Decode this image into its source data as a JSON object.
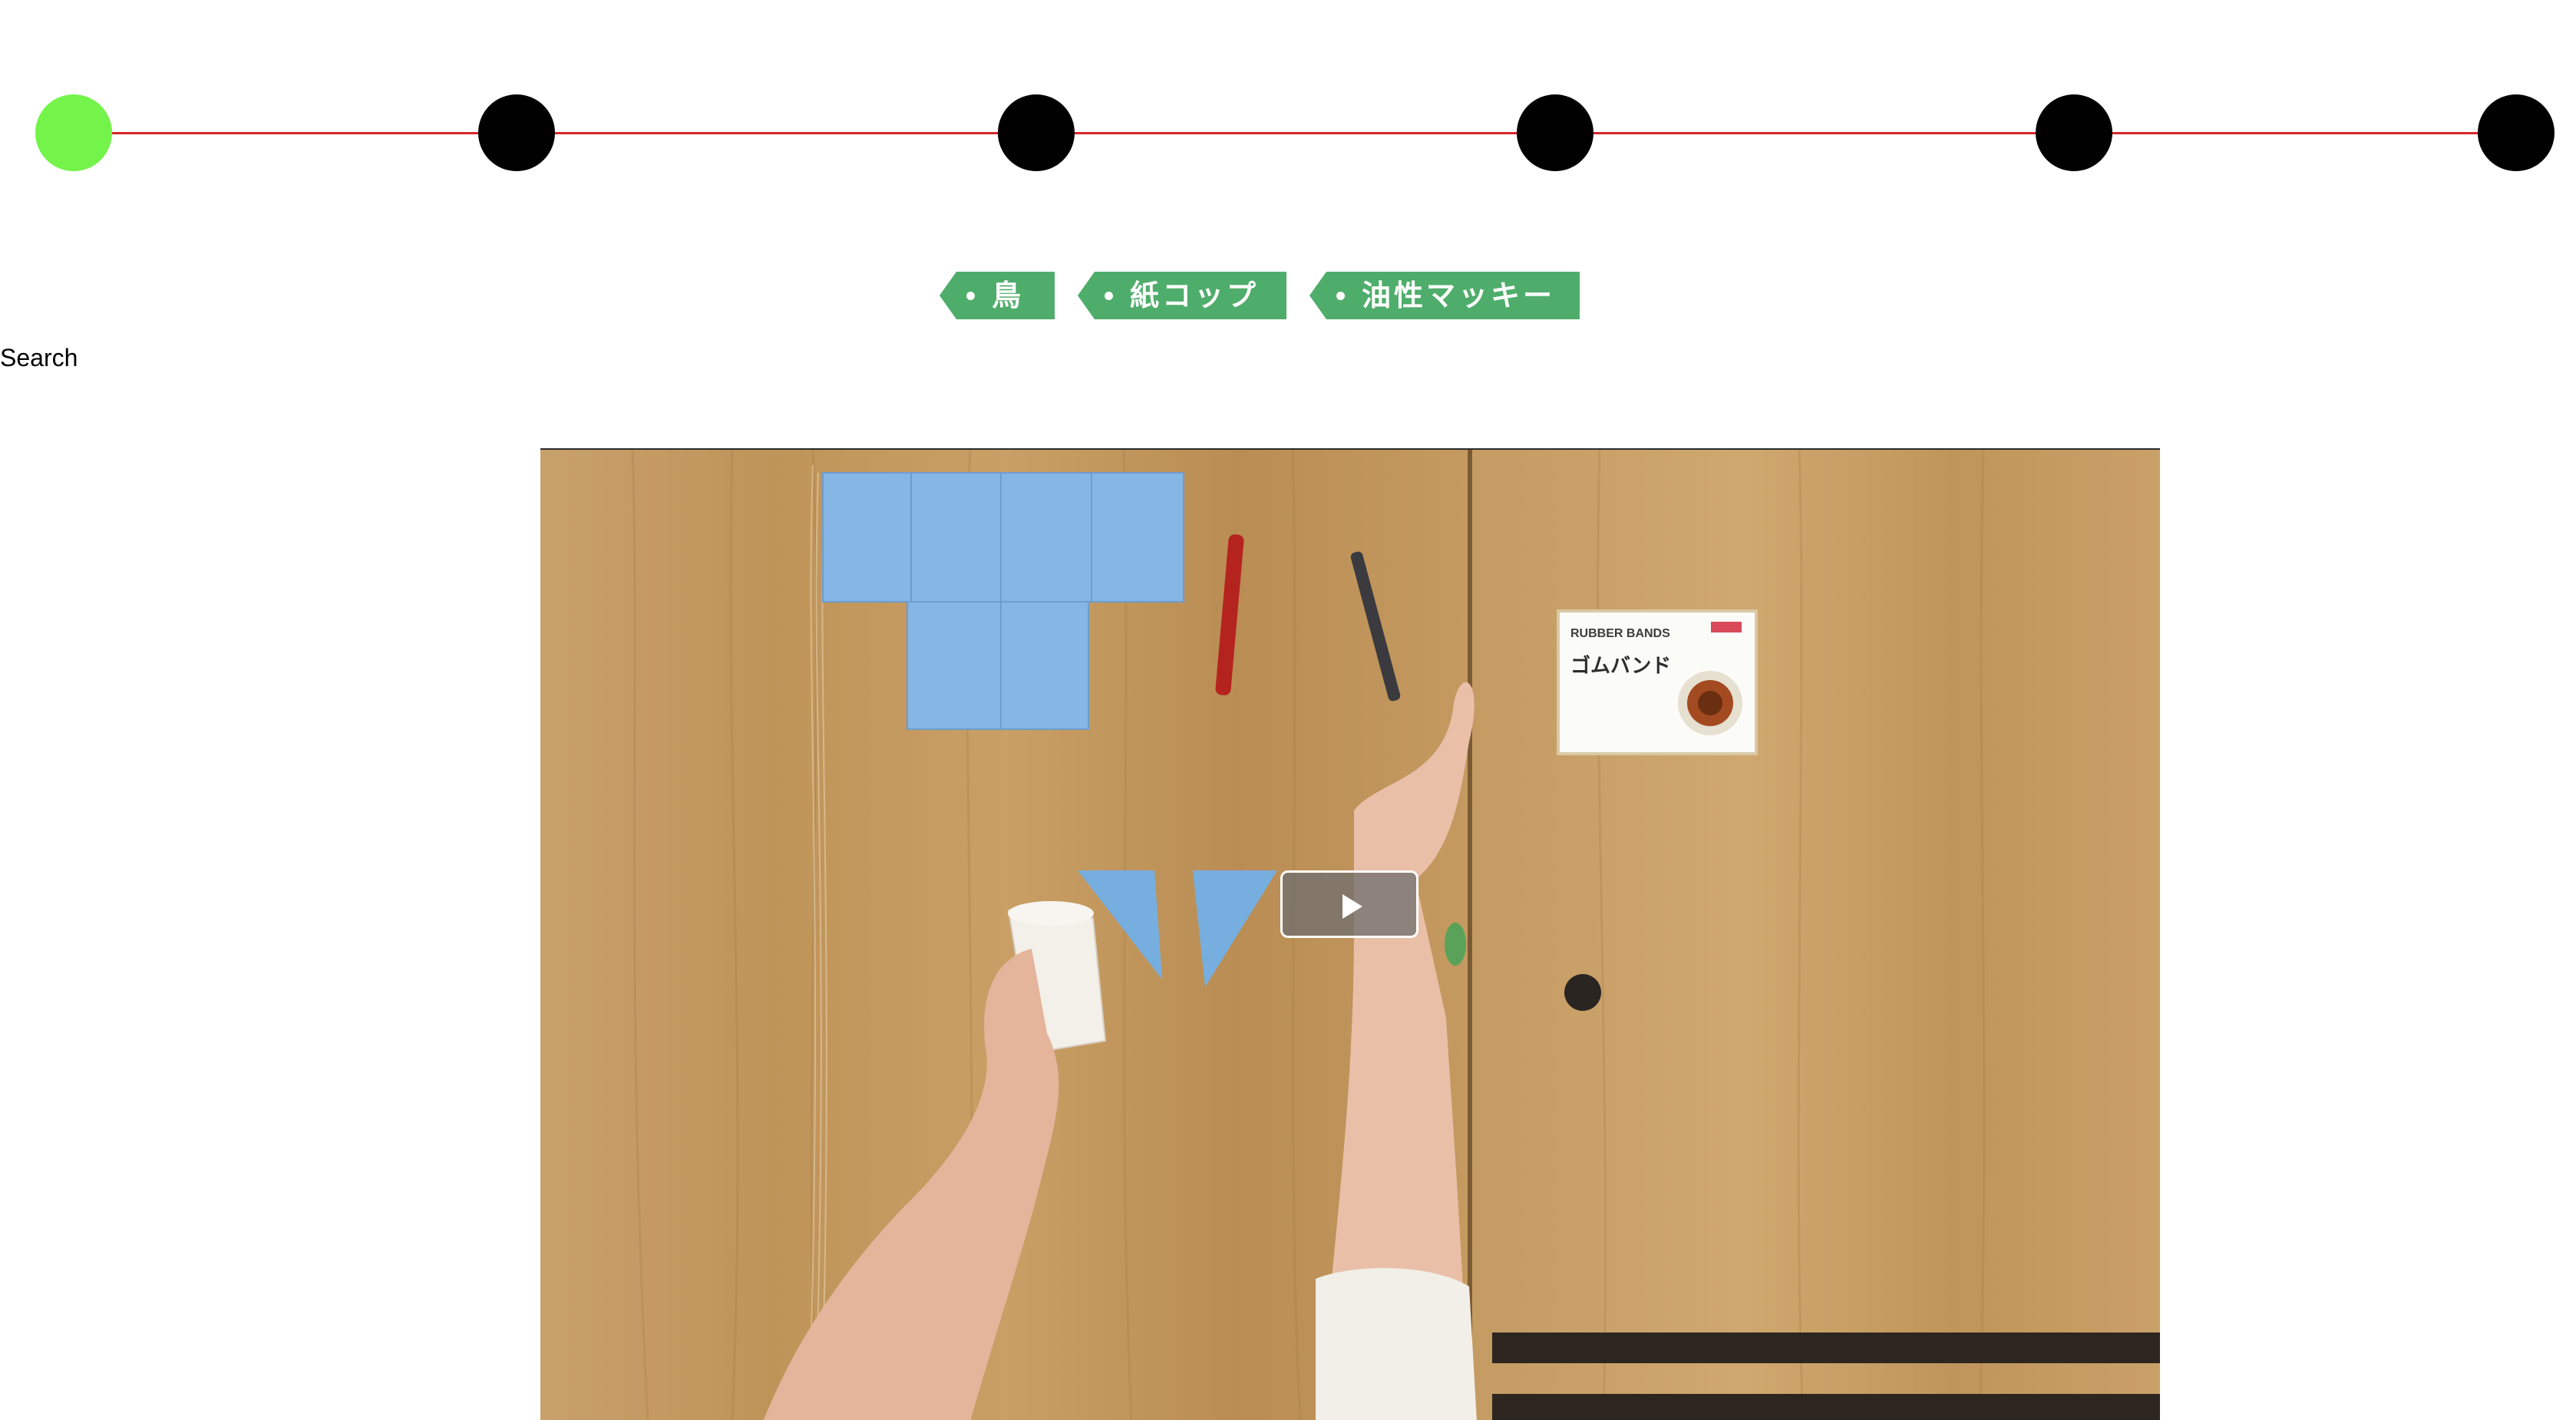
{
  "timeline": {
    "steps": [
      {
        "state": "current"
      },
      {
        "state": "pending"
      },
      {
        "state": "pending"
      },
      {
        "state": "pending"
      },
      {
        "state": "pending"
      },
      {
        "state": "pending"
      }
    ],
    "colors": {
      "line": "#d7262b",
      "current": "#74f44a",
      "pending": "#000000"
    }
  },
  "tags": [
    {
      "label": "鳥"
    },
    {
      "label": "紙コップ"
    },
    {
      "label": "油性マッキー"
    }
  ],
  "tag_color": "#4fad6b",
  "search": {
    "label": "Search"
  },
  "video": {
    "package_label": "ゴムバンド",
    "package_label_en": "RUBBER BANDS",
    "play_icon": "play-icon"
  }
}
